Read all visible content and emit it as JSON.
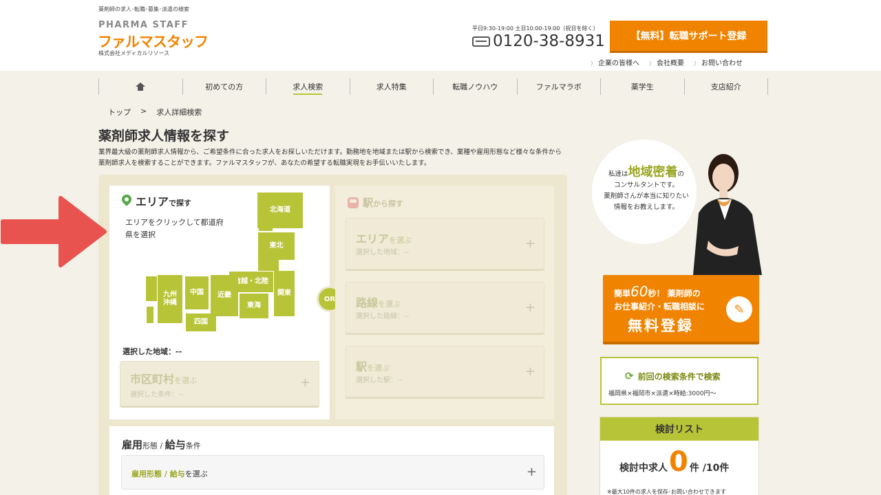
{
  "header": {
    "tagline": "薬剤師の求人･転職･募集･派遣の検索",
    "logo_top": "PHARMA STAFF",
    "logo_main": "ファルマスタッフ",
    "logo_sub": "株式会社メディカルリソース",
    "hours": "平日9:30-19:00 土日10:00-19:00（祝日を除く）",
    "phone": "0120-38-8931",
    "register_button": "【無料】転職サポート登録",
    "sublinks": [
      "企業の皆様へ",
      "会社概要",
      "お問い合わせ"
    ]
  },
  "nav": {
    "items": [
      "初めての方",
      "求人検索",
      "求人特集",
      "転職ノウハウ",
      "ファルマラボ",
      "薬学生",
      "支店紹介"
    ]
  },
  "breadcrumb": [
    "トップ",
    ">",
    "求人詳細検索"
  ],
  "page": {
    "title": "薬剤師求人情報を探す",
    "intro": "業界最大級の薬剤師求人情報から、ご希望条件に合った求人をお探しいただけます。勤務地を地域または駅から検索でき、業種や雇用形態など様々な条件から薬剤師求人を検索することができます。ファルマスタッフが、あなたの希望する転職実現をお手伝いいたします。"
  },
  "area_search": {
    "title": "エリア",
    "title_suffix": "で探す",
    "help": "エリアをクリックして都道府県を選択",
    "regions": {
      "hokkaido": "北海道",
      "tohoku": "東北",
      "shinetsu": "信越・北陸",
      "kanto": "関東",
      "tokai": "東海",
      "kinki": "近畿",
      "chugoku": "中国",
      "shikoku": "四国",
      "kyushu": "九州\n沖縄"
    },
    "selected_label": "選択した地域：--",
    "city_title": "市区町村",
    "city_suffix": "を選ぶ",
    "city_selected": "選択した条件：--"
  },
  "or_label": "OR",
  "station_search": {
    "title": "駅",
    "title_suffix": "から探す",
    "cards": [
      {
        "title": "エリア",
        "suffix": "を選ぶ",
        "sub": "選択した地域：--"
      },
      {
        "title": "路線",
        "suffix": "を選ぶ",
        "sub": "選択した路線：--"
      },
      {
        "title": "駅",
        "suffix": "を選ぶ",
        "sub": "選択した駅：--"
      }
    ]
  },
  "employment": {
    "title_a": "雇用",
    "title_a_small": "形態",
    "title_sep": " / ",
    "title_b": "給与",
    "title_b_small": "条件",
    "card_label_a": "雇用形態",
    "card_sep": " / ",
    "card_label_b": "給与",
    "card_suffix": "を選ぶ"
  },
  "sidebar": {
    "consult_pre": "私達は",
    "consult_hl": "地域密着",
    "consult_post": "の",
    "consult_line2": "コンサルタントです。",
    "consult_line3": "薬剤師さんが本当に知りたい",
    "consult_line4": "情報をお教えします。",
    "signup_a": "簡単",
    "signup_num": "60",
    "signup_b": "秒！ 薬剤師の",
    "signup_line2": "お仕事紹介・転職相談に",
    "signup_line3": "無料登録",
    "prev_title": "前回の検索条件で検索",
    "prev_detail": "福岡県×福岡市×派遣×時給:3000円〜",
    "list_title": "検討リスト",
    "list_pre": "検討中求人",
    "list_count": "0",
    "list_post": "件 /10件",
    "list_note": "※最大10件の求人を保存･お問い合わせできます"
  },
  "colors": {
    "accent_green": "#b8c437",
    "orange": "#f08300",
    "arrow_red": "#e8524f"
  }
}
